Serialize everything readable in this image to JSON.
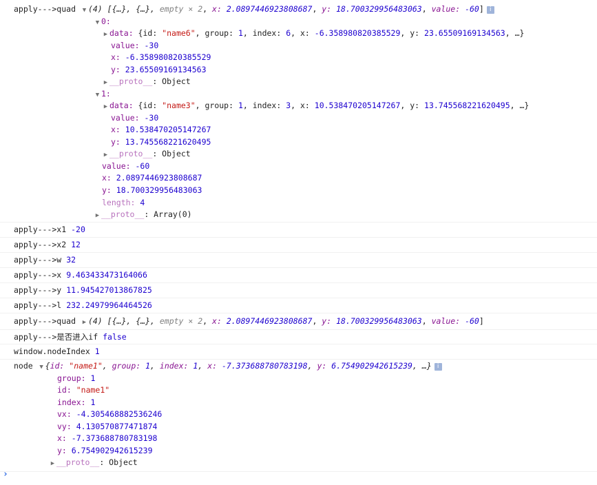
{
  "quad1": {
    "label": "apply--->quad",
    "count": "(4)",
    "preview_pre": "[{…}, {…}, ",
    "empty": "empty × 2",
    "preview_x_k": "x:",
    "preview_x_v": "2.0897446923808687",
    "preview_y_k": "y:",
    "preview_y_v": "18.700329956483063",
    "preview_val_k": "value:",
    "preview_val_v": "-60",
    "info": "i",
    "items": [
      {
        "index": "0:",
        "data_key": "data:",
        "data_id_v": "\"name6\"",
        "data_group_v": "1",
        "data_index_v": "6",
        "data_x_v": "-6.358980820385529",
        "data_y_v": "23.65509169134563",
        "value_k": "value:",
        "value_v": "-30",
        "x_k": "x:",
        "x_v": "-6.358980820385529",
        "y_k": "y:",
        "y_v": "23.65509169134563",
        "proto_k": "__proto__",
        "proto_v": "Object"
      },
      {
        "index": "1:",
        "data_key": "data:",
        "data_id_v": "\"name3\"",
        "data_group_v": "1",
        "data_index_v": "3",
        "data_x_v": "10.538470205147267",
        "data_y_v": "13.745568221620495",
        "value_k": "value:",
        "value_v": "-30",
        "x_k": "x:",
        "x_v": "10.538470205147267",
        "y_k": "y:",
        "y_v": "13.745568221620495",
        "proto_k": "__proto__",
        "proto_v": "Object"
      }
    ],
    "value_k": "value:",
    "value_v": "-60",
    "x_k": "x:",
    "x_v": "2.0897446923808687",
    "y_k": "y:",
    "y_v": "18.700329956483063",
    "length_k": "length:",
    "length_v": "4",
    "proto_k": "__proto__",
    "proto_v": "Array(0)"
  },
  "logs": [
    {
      "label": "apply--->x1",
      "value": "-20"
    },
    {
      "label": "apply--->x2",
      "value": "12"
    },
    {
      "label": "apply--->w",
      "value": "32"
    },
    {
      "label": "apply--->x",
      "value": "9.463433473164066"
    },
    {
      "label": "apply--->y",
      "value": "11.945427013867825"
    },
    {
      "label": "apply--->l",
      "value": "232.24979964464526"
    }
  ],
  "quad2": {
    "label": "apply--->quad",
    "count": "(4)",
    "preview_pre": "[{…}, {…}, ",
    "empty": "empty × 2",
    "x_k": "x:",
    "x_v": "2.0897446923808687",
    "y_k": "y:",
    "y_v": "18.700329956483063",
    "val_k": "value:",
    "val_v": "-60"
  },
  "ifline": {
    "label": "apply--->是否进入if",
    "value": "false"
  },
  "nodeindex": {
    "label": "window.nodeIndex",
    "value": "1"
  },
  "node": {
    "label": "node",
    "preview_id_v": "\"name1\"",
    "preview_group_v": "1",
    "preview_index_v": "1",
    "preview_x_v": "-7.373688780783198",
    "preview_y_v": "6.754902942615239",
    "info": "i",
    "props": [
      {
        "k": "group:",
        "v": "1",
        "type": "n"
      },
      {
        "k": "id:",
        "v": "\"name1\"",
        "type": "s"
      },
      {
        "k": "index:",
        "v": "1",
        "type": "n"
      },
      {
        "k": "vx:",
        "v": "-4.305468882536246",
        "type": "n"
      },
      {
        "k": "vy:",
        "v": "4.130570877471874",
        "type": "n"
      },
      {
        "k": "x:",
        "v": "-7.373688780783198",
        "type": "n"
      },
      {
        "k": "y:",
        "v": "6.754902942615239",
        "type": "n"
      }
    ],
    "proto_k": "__proto__",
    "proto_v": "Object"
  },
  "prompt": "›"
}
